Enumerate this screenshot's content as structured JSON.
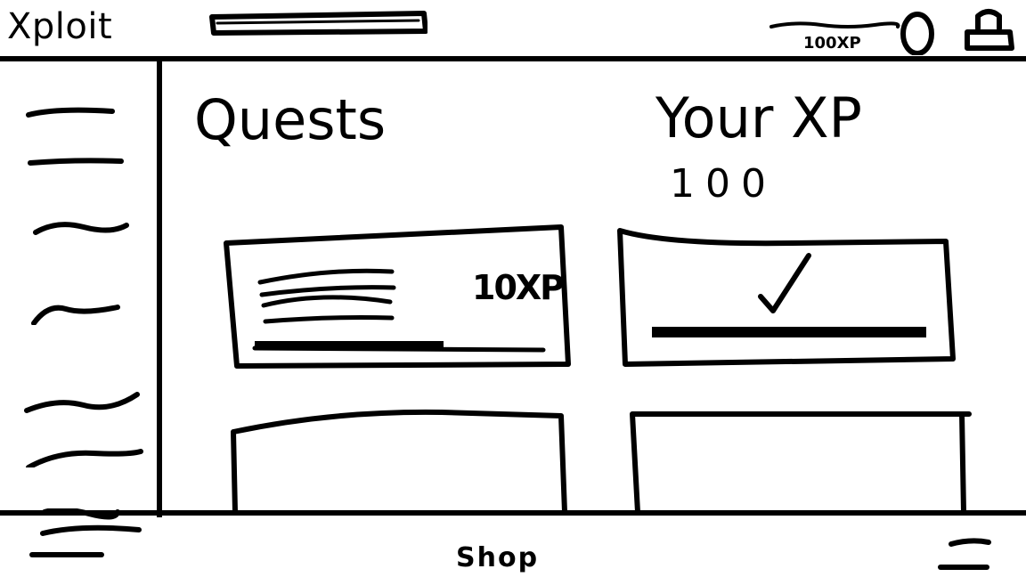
{
  "header": {
    "brand": "Xploit",
    "xp_badge": "100XP",
    "icons": [
      "search-bar",
      "coin-icon",
      "lock-icon"
    ]
  },
  "sidebar": {
    "items": [
      {
        "name": "sidebar-item-1"
      },
      {
        "name": "sidebar-item-2"
      },
      {
        "name": "sidebar-item-3"
      },
      {
        "name": "sidebar-item-4"
      },
      {
        "name": "sidebar-item-5"
      },
      {
        "name": "sidebar-item-6"
      }
    ]
  },
  "main": {
    "quests_title": "Quests",
    "xp_title": "Your XP",
    "xp_value": "100",
    "quest_cards": [
      {
        "reward": "10XP",
        "progress": 0.7,
        "status": "in-progress"
      },
      {
        "status": "completed",
        "progress": 1.0,
        "icon": "checkmark-icon"
      },
      {
        "status": "empty"
      },
      {
        "status": "empty"
      }
    ]
  },
  "footer": {
    "shop_label": "Shop"
  }
}
